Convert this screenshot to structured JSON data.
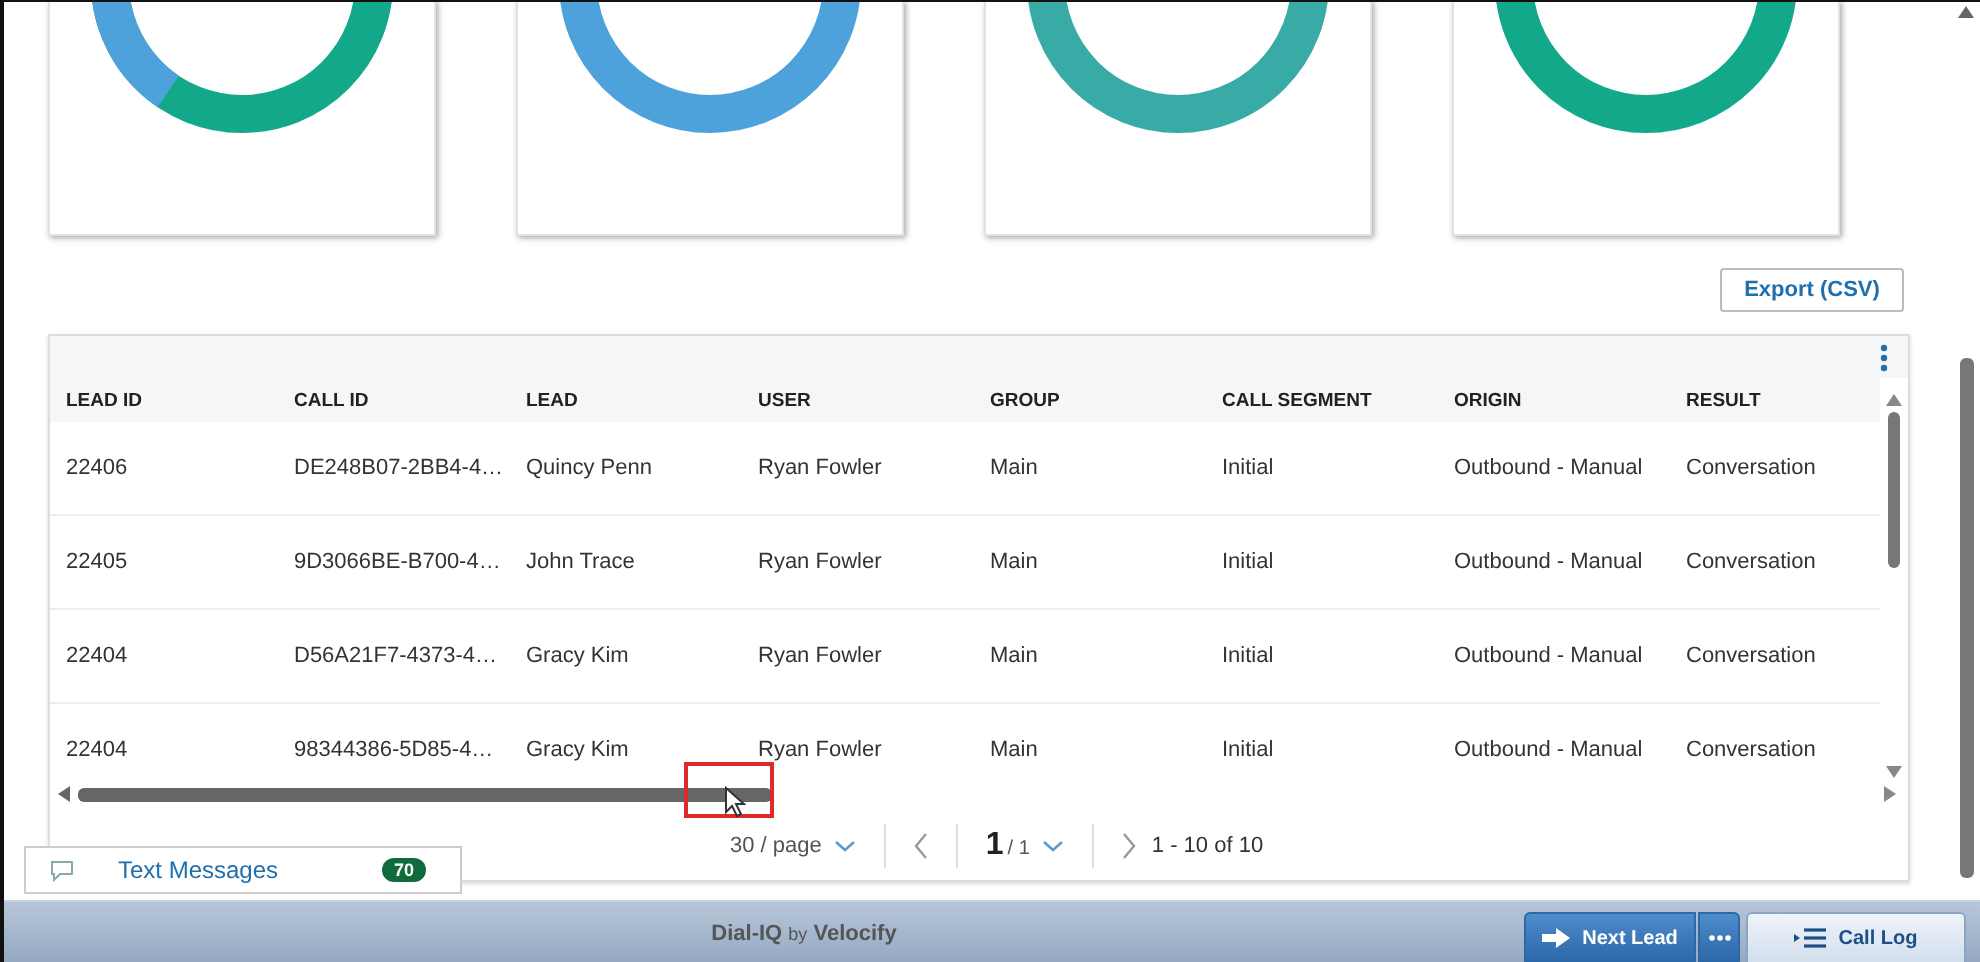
{
  "charts": [
    {
      "segments": [
        {
          "color": "#4ea2db"
        },
        {
          "color": "#12a889"
        }
      ]
    },
    {
      "segments": [
        {
          "color": "#4ea2db"
        }
      ]
    },
    {
      "segments": [
        {
          "color": "#38aba6"
        }
      ]
    },
    {
      "segments": [
        {
          "color": "#12a889"
        }
      ]
    }
  ],
  "export_button": "Export (CSV)",
  "table": {
    "columns": [
      "LEAD ID",
      "CALL ID",
      "LEAD",
      "USER",
      "GROUP",
      "CALL SEGMENT",
      "ORIGIN",
      "RESULT"
    ],
    "rows": [
      [
        "22406",
        "DE248B07-2BB4-4…",
        "Quincy Penn",
        "Ryan Fowler",
        "Main",
        "Initial",
        "Outbound - Manual",
        "Conversation"
      ],
      [
        "22405",
        "9D3066BE-B700-4…",
        "John Trace",
        "Ryan Fowler",
        "Main",
        "Initial",
        "Outbound - Manual",
        "Conversation"
      ],
      [
        "22404",
        "D56A21F7-4373-4…",
        "Gracy Kim",
        "Ryan Fowler",
        "Main",
        "Initial",
        "Outbound - Manual",
        "Conversation"
      ],
      [
        "22404",
        "98344386-5D85-4…",
        "Gracy Kim",
        "Ryan Fowler",
        "Main",
        "Initial",
        "Outbound - Manual",
        "Conversation"
      ]
    ]
  },
  "pagination": {
    "page_size": "30 / page",
    "page": "1",
    "total_pages": "/ 1",
    "range": "1 - 10 of 10"
  },
  "text_messages": {
    "label": "Text Messages",
    "count": "70"
  },
  "footer": {
    "brand": "Dial-IQ",
    "by": "by",
    "company": "Velocify",
    "next_lead": "Next Lead",
    "call_log": "Call Log"
  }
}
